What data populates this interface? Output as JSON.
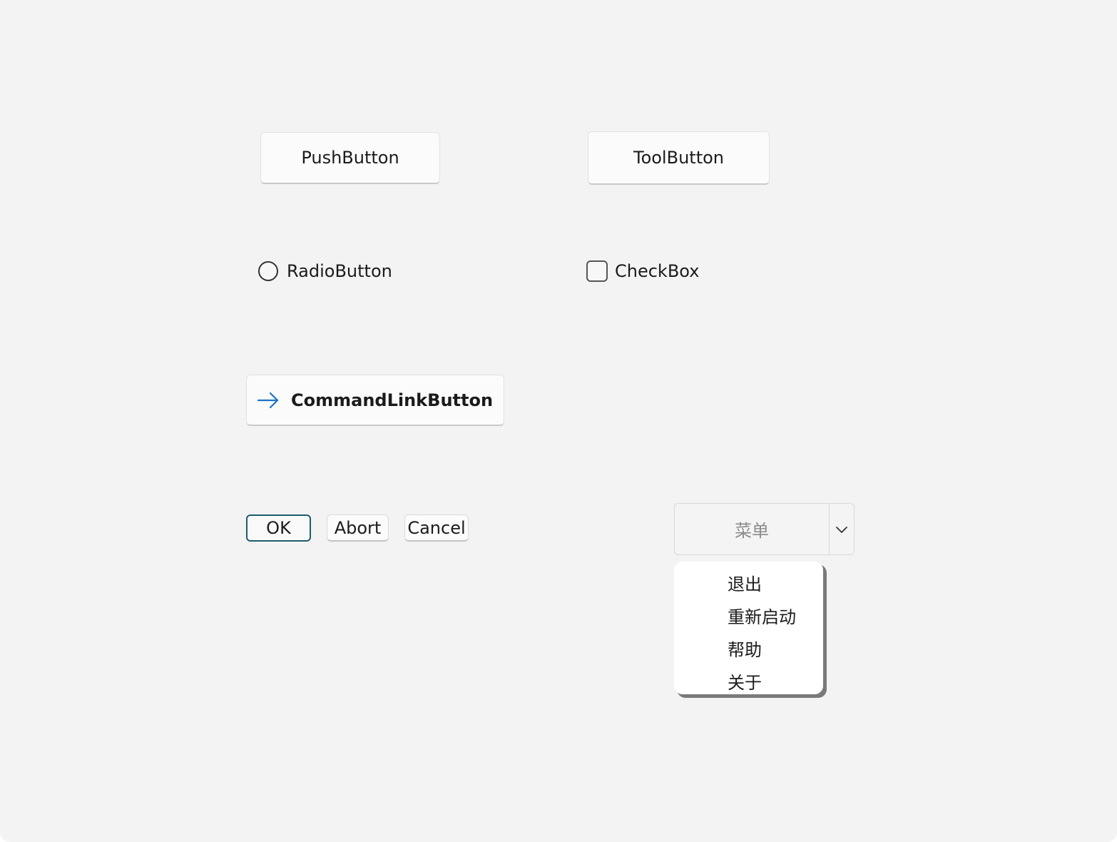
{
  "buttons": {
    "push": "PushButton",
    "tool": "ToolButton",
    "command_link": "CommandLinkButton"
  },
  "radio": {
    "label": "RadioButton",
    "checked": false
  },
  "checkbox": {
    "label": "CheckBox",
    "checked": false
  },
  "dialog_buttons": {
    "ok": "OK",
    "abort": "Abort",
    "cancel": "Cancel"
  },
  "menu_button": {
    "label": "菜单",
    "items": [
      "退出",
      "重新启动",
      "帮助",
      "关于"
    ]
  },
  "colors": {
    "window_bg": "#f3f3f3",
    "button_bg": "#fbfbfb",
    "focus_border": "#1d5e6e",
    "command_link_arrow": "#1a73c8",
    "popup_shadow": "#7a7a7a"
  },
  "icons": {
    "command_link": "arrow-right-icon",
    "menu_dropdown": "chevron-down-icon"
  }
}
